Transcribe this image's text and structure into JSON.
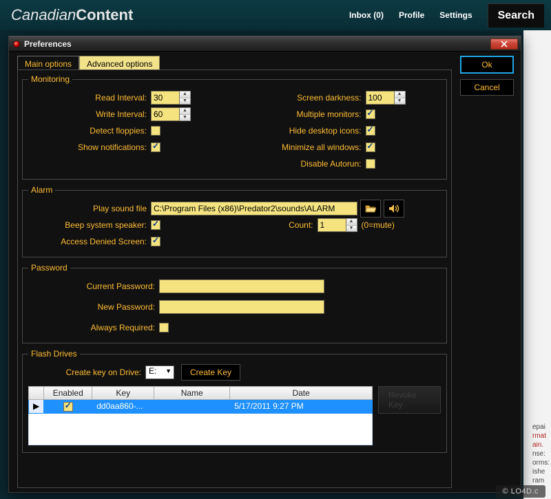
{
  "bg": {
    "logo_a": "Canadian",
    "logo_b": "Content",
    "nav": {
      "inbox": "Inbox (0)",
      "profile": "Profile",
      "settings": "Settings"
    },
    "search": "Search",
    "blurb": [
      "epai",
      "rmat",
      "ain.",
      "nse:",
      "orms:",
      "ishe",
      "ram"
    ]
  },
  "watermark": "© LO4D.c",
  "dialog": {
    "title": "Preferences",
    "close_label": "×",
    "ok": "Ok",
    "cancel": "Cancel",
    "tabs": {
      "main": "Main options",
      "advanced": "Advanced options"
    }
  },
  "monitoring": {
    "legend": "Monitoring",
    "read_interval_label": "Read Interval:",
    "read_interval_value": "30",
    "write_interval_label": "Write Interval:",
    "write_interval_value": "60",
    "detect_floppies_label": "Detect floppies:",
    "detect_floppies_checked": false,
    "show_notifications_label": "Show notifications:",
    "show_notifications_checked": true,
    "screen_darkness_label": "Screen darkness:",
    "screen_darkness_value": "100",
    "multiple_monitors_label": "Multiple monitors:",
    "multiple_monitors_checked": true,
    "hide_desktop_label": "Hide desktop icons:",
    "hide_desktop_checked": true,
    "minimize_all_label": "Minimize all windows:",
    "minimize_all_checked": true,
    "disable_autorun_label": "Disable Autorun:",
    "disable_autorun_checked": false
  },
  "alarm": {
    "legend": "Alarm",
    "play_sound_label": "Play sound file",
    "play_sound_path": "C:\\Program Files (x86)\\Predator2\\sounds\\ALARM",
    "browse_icon": "folder-open-icon",
    "play_icon": "speaker-icon",
    "beep_label": "Beep system speaker:",
    "beep_checked": true,
    "count_label": "Count:",
    "count_value": "1",
    "count_hint": "(0=mute)",
    "access_denied_label": "Access Denied Screen:",
    "access_denied_checked": true
  },
  "password": {
    "legend": "Password",
    "current_label": "Current Password:",
    "current_value": "",
    "new_label": "New Password:",
    "new_value": "",
    "always_required_label": "Always Required:",
    "always_required_checked": false
  },
  "flash": {
    "legend": "Flash Drives",
    "create_key_label": "Create key on Drive:",
    "drive_value": "E:",
    "create_key_btn": "Create Key",
    "revoke_key_btn": "Revoke Key",
    "columns": {
      "enabled": "Enabled",
      "key": "Key",
      "name": "Name",
      "date": "Date"
    },
    "rows": [
      {
        "nav": "▶",
        "enabled": true,
        "key": "dd0aa860-...",
        "name": "",
        "date": "5/17/2011 9:27 PM"
      }
    ]
  }
}
